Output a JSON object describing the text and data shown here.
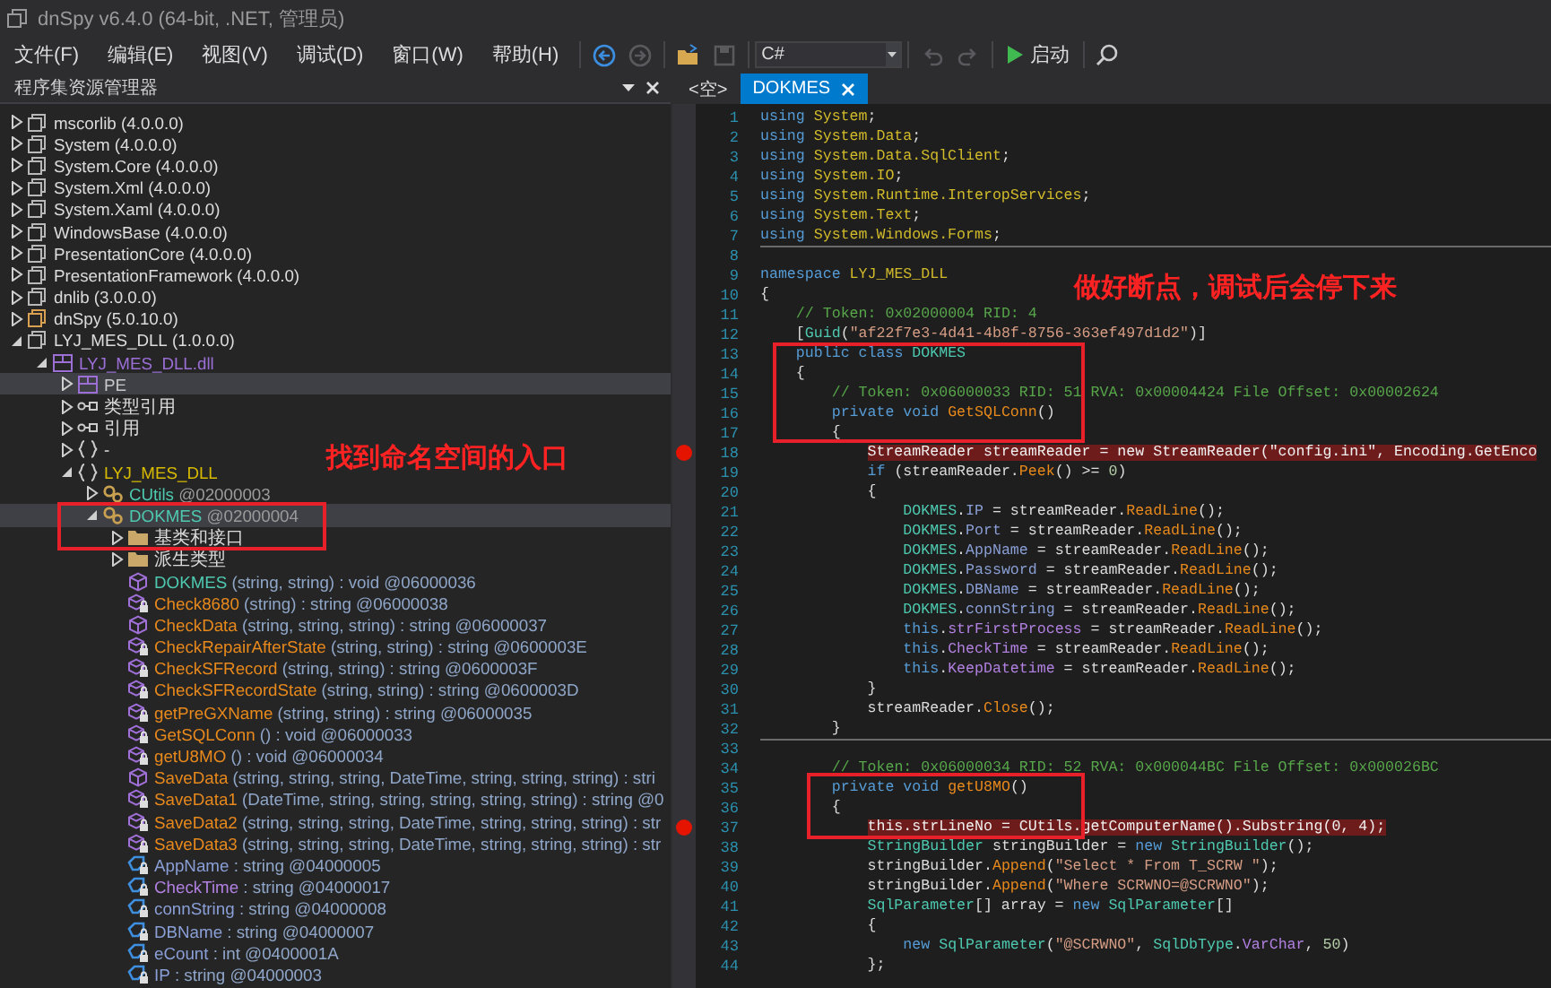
{
  "window": {
    "title": "dnSpy v6.4.0 (64-bit, .NET, 管理员)"
  },
  "menu": [
    "文件(F)",
    "编辑(E)",
    "视图(V)",
    "调试(D)",
    "窗口(W)",
    "帮助(H)"
  ],
  "toolbar": {
    "nav": [
      {
        "kind": "back",
        "disabled": false
      },
      {
        "kind": "forward",
        "disabled": true
      },
      {
        "kind": "open",
        "disabled": false
      },
      {
        "kind": "save",
        "disabled": true
      }
    ],
    "language": "C#",
    "history": [
      {
        "kind": "undo",
        "disabled": true
      },
      {
        "kind": "redo",
        "disabled": true
      }
    ],
    "start_label": "启动"
  },
  "explorer": {
    "title": "程序集资源管理器",
    "tree": [
      {
        "kind": "assembly",
        "name": "mscorlib",
        "detail": "(4.0.0.0)",
        "expanded": false,
        "selected": false
      },
      {
        "kind": "assembly",
        "name": "System",
        "detail": "(4.0.0.0)",
        "expanded": false,
        "selected": false
      },
      {
        "kind": "assembly",
        "name": "System.Core",
        "detail": "(4.0.0.0)",
        "expanded": false,
        "selected": false
      },
      {
        "kind": "assembly",
        "name": "System.Xml",
        "detail": "(4.0.0.0)",
        "expanded": false,
        "selected": false
      },
      {
        "kind": "assembly",
        "name": "System.Xaml",
        "detail": "(4.0.0.0)",
        "expanded": false,
        "selected": false
      },
      {
        "kind": "assembly",
        "name": "WindowsBase",
        "detail": "(4.0.0.0)",
        "expanded": false,
        "selected": false
      },
      {
        "kind": "assembly",
        "name": "PresentationCore",
        "detail": "(4.0.0.0)",
        "expanded": false,
        "selected": false
      },
      {
        "kind": "assembly",
        "name": "PresentationFramework",
        "detail": "(4.0.0.0)",
        "expanded": false,
        "selected": false
      },
      {
        "kind": "assembly",
        "name": "dnlib",
        "detail": "(3.0.0.0)",
        "expanded": false,
        "selected": false
      },
      {
        "kind": "exe-assembly",
        "name": "dnSpy",
        "detail": "(5.0.10.0)",
        "expanded": false,
        "selected": false
      },
      {
        "kind": "assembly",
        "name": "LYJ_MES_DLL",
        "detail": "(1.0.0.0)",
        "expanded": true,
        "selected": false,
        "children": [
          {
            "kind": "module",
            "name": "LYJ_MES_DLL.dll",
            "expanded": true,
            "selected": false,
            "children": [
              {
                "kind": "pe",
                "name": "PE",
                "expanded": false,
                "selected": true
              },
              {
                "kind": "references",
                "name": "类型引用",
                "expanded": false,
                "selected": false
              },
              {
                "kind": "references",
                "name": "引用",
                "expanded": false,
                "selected": false
              },
              {
                "kind": "global-namespace",
                "name": "-",
                "expanded": false,
                "selected": false
              },
              {
                "kind": "namespace",
                "name": "LYJ_MES_DLL",
                "expanded": true,
                "selected": false,
                "children": [
                  {
                    "kind": "class",
                    "name": "CUtils",
                    "detail": "@02000003",
                    "expanded": false,
                    "selected": false
                  },
                  {
                    "kind": "class",
                    "name": "DOKMES",
                    "detail": "@02000004",
                    "expanded": true,
                    "selected": true,
                    "children": [
                      {
                        "kind": "folder",
                        "name": "基类和接口",
                        "expanded": false,
                        "selected": false
                      },
                      {
                        "kind": "folder",
                        "name": "派生类型",
                        "expanded": false,
                        "selected": false
                      },
                      {
                        "kind": "constructor",
                        "name": "DOKMES",
                        "detail": "(string, string) : void @06000036",
                        "selected": false
                      },
                      {
                        "kind": "private-method",
                        "name": "Check8680",
                        "detail": "(string) : string @06000038",
                        "selected": false
                      },
                      {
                        "kind": "method",
                        "name": "CheckData",
                        "detail": "(string, string, string) : string @06000037",
                        "selected": false
                      },
                      {
                        "kind": "private-method",
                        "name": "CheckRepairAfterState",
                        "detail": "(string, string) : string @0600003E",
                        "selected": false
                      },
                      {
                        "kind": "private-method",
                        "name": "CheckSFRecord",
                        "detail": "(string, string) : string @0600003F",
                        "selected": false
                      },
                      {
                        "kind": "private-method",
                        "name": "CheckSFRecordState",
                        "detail": "(string, string) : string @0600003D",
                        "selected": false
                      },
                      {
                        "kind": "private-method",
                        "name": "getPreGXName",
                        "detail": "(string, string) : string @06000035",
                        "selected": false
                      },
                      {
                        "kind": "private-method",
                        "name": "GetSQLConn",
                        "detail": "() : void @06000033",
                        "selected": false
                      },
                      {
                        "kind": "private-method",
                        "name": "getU8MO",
                        "detail": "() : void @06000034",
                        "selected": false
                      },
                      {
                        "kind": "method",
                        "name": "SaveData",
                        "detail": "(string, string, string, DateTime, string, string, string) : stri",
                        "selected": false
                      },
                      {
                        "kind": "private-method",
                        "name": "SaveData1",
                        "detail": "(DateTime, string, string, string, string, string) : string @0",
                        "selected": false
                      },
                      {
                        "kind": "private-method",
                        "name": "SaveData2",
                        "detail": "(string, string, string, DateTime, string, string, string) : str",
                        "selected": false
                      },
                      {
                        "kind": "private-method",
                        "name": "SaveData3",
                        "detail": "(string, string, string, DateTime, string, string, string) : str",
                        "selected": false
                      },
                      {
                        "kind": "static-field",
                        "name": "AppName",
                        "detail": ": string @04000005",
                        "selected": false
                      },
                      {
                        "kind": "field",
                        "name": "CheckTime",
                        "detail": ": string @04000017",
                        "selected": false
                      },
                      {
                        "kind": "static-field",
                        "name": "connString",
                        "detail": ": string @04000008",
                        "selected": false
                      },
                      {
                        "kind": "static-field",
                        "name": "DBName",
                        "detail": ": string @04000007",
                        "selected": false
                      },
                      {
                        "kind": "static-field",
                        "name": "eCount",
                        "detail": ": int @0400001A",
                        "selected": false
                      },
                      {
                        "kind": "static-field",
                        "name": "IP",
                        "detail": ": string @04000003",
                        "selected": false
                      }
                    ]
                  }
                ]
              }
            ]
          }
        ]
      }
    ]
  },
  "tabs": [
    {
      "label": "<空>",
      "selected": false
    },
    {
      "label": "DOKMES",
      "selected": true
    }
  ],
  "code": {
    "lines": [
      {
        "number": "1",
        "breakpoint": false,
        "divider": false,
        "tokens": [
          {
            "kind": "kw",
            "text": "using "
          },
          {
            "kind": "ns",
            "text": "System"
          },
          {
            "kind": "p",
            "text": ";"
          }
        ]
      },
      {
        "number": "2",
        "breakpoint": false,
        "divider": false,
        "tokens": [
          {
            "kind": "kw",
            "text": "using "
          },
          {
            "kind": "ns",
            "text": "System.Data"
          },
          {
            "kind": "p",
            "text": ";"
          }
        ]
      },
      {
        "number": "3",
        "breakpoint": false,
        "divider": false,
        "tokens": [
          {
            "kind": "kw",
            "text": "using "
          },
          {
            "kind": "ns",
            "text": "System.Data.SqlClient"
          },
          {
            "kind": "p",
            "text": ";"
          }
        ]
      },
      {
        "number": "4",
        "breakpoint": false,
        "divider": false,
        "tokens": [
          {
            "kind": "kw",
            "text": "using "
          },
          {
            "kind": "ns",
            "text": "System.IO"
          },
          {
            "kind": "p",
            "text": ";"
          }
        ]
      },
      {
        "number": "5",
        "breakpoint": false,
        "divider": false,
        "tokens": [
          {
            "kind": "kw",
            "text": "using "
          },
          {
            "kind": "ns",
            "text": "System.Runtime.InteropServices"
          },
          {
            "kind": "p",
            "text": ";"
          }
        ]
      },
      {
        "number": "6",
        "breakpoint": false,
        "divider": false,
        "tokens": [
          {
            "kind": "kw",
            "text": "using "
          },
          {
            "kind": "ns",
            "text": "System.Text"
          },
          {
            "kind": "p",
            "text": ";"
          }
        ]
      },
      {
        "number": "7",
        "breakpoint": false,
        "divider": false,
        "tokens": [
          {
            "kind": "kw",
            "text": "using "
          },
          {
            "kind": "ns",
            "text": "System.Windows.Forms"
          },
          {
            "kind": "p",
            "text": ";"
          }
        ]
      },
      {
        "number": "8",
        "breakpoint": false,
        "divider": true
      },
      {
        "number": "9",
        "breakpoint": false,
        "divider": false,
        "tokens": [
          {
            "kind": "kw",
            "text": "namespace "
          },
          {
            "kind": "ns",
            "text": "LYJ_MES_DLL"
          }
        ]
      },
      {
        "number": "10",
        "breakpoint": false,
        "divider": false,
        "tokens": [
          {
            "kind": "p",
            "text": "{"
          }
        ]
      },
      {
        "number": "11",
        "breakpoint": false,
        "divider": false,
        "tokens": [
          {
            "kind": "comment",
            "text": "    // Token: 0x02000004 RID: 4"
          }
        ]
      },
      {
        "number": "12",
        "breakpoint": false,
        "divider": false,
        "tokens": [
          {
            "kind": "p",
            "text": "    ["
          },
          {
            "kind": "type",
            "text": "Guid"
          },
          {
            "kind": "p",
            "text": "("
          },
          {
            "kind": "str",
            "text": "\"af22f7e3-4d41-4b8f-8756-363ef497d1d2\""
          },
          {
            "kind": "p",
            "text": ")]"
          }
        ]
      },
      {
        "number": "13",
        "breakpoint": false,
        "divider": false,
        "tokens": [
          {
            "kind": "kw",
            "text": "    public class "
          },
          {
            "kind": "type",
            "text": "DOKMES"
          }
        ]
      },
      {
        "number": "14",
        "breakpoint": false,
        "divider": false,
        "tokens": [
          {
            "kind": "p",
            "text": "    {"
          }
        ]
      },
      {
        "number": "15",
        "breakpoint": false,
        "divider": false,
        "tokens": [
          {
            "kind": "comment",
            "text": "        // Token: 0x06000033 RID: 51 RVA: 0x00004424 File Offset: 0x00002624"
          }
        ]
      },
      {
        "number": "16",
        "breakpoint": false,
        "divider": false,
        "tokens": [
          {
            "kind": "kw",
            "text": "        private void "
          },
          {
            "kind": "method",
            "text": "GetSQLConn"
          },
          {
            "kind": "p",
            "text": "()"
          }
        ]
      },
      {
        "number": "17",
        "breakpoint": false,
        "divider": false,
        "tokens": [
          {
            "kind": "p",
            "text": "        {"
          }
        ]
      },
      {
        "number": "18",
        "breakpoint": true,
        "divider": false,
        "tokens": [
          {
            "kind": "type",
            "text": "            StreamReader"
          },
          {
            "kind": "p",
            "text": " streamReader = "
          },
          {
            "kind": "kw",
            "text": "new "
          },
          {
            "kind": "type",
            "text": "StreamReader"
          },
          {
            "kind": "p",
            "text": "("
          },
          {
            "kind": "str",
            "text": "\"config.ini\""
          },
          {
            "kind": "p",
            "text": ", "
          },
          {
            "kind": "type",
            "text": "Encoding"
          },
          {
            "kind": "p",
            "text": "."
          },
          {
            "kind": "method",
            "text": "GetEnco"
          }
        ]
      },
      {
        "number": "19",
        "breakpoint": false,
        "divider": false,
        "tokens": [
          {
            "kind": "kw",
            "text": "            if"
          },
          {
            "kind": "p",
            "text": " (streamReader."
          },
          {
            "kind": "method",
            "text": "Peek"
          },
          {
            "kind": "p",
            "text": "() >= "
          },
          {
            "kind": "num",
            "text": "0"
          },
          {
            "kind": "p",
            "text": ")"
          }
        ]
      },
      {
        "number": "20",
        "breakpoint": false,
        "divider": false,
        "tokens": [
          {
            "kind": "p",
            "text": "            {"
          }
        ]
      },
      {
        "number": "21",
        "breakpoint": false,
        "divider": false,
        "tokens": [
          {
            "kind": "type",
            "text": "                DOKMES"
          },
          {
            "kind": "p",
            "text": "."
          },
          {
            "kind": "sfield",
            "text": "IP"
          },
          {
            "kind": "p",
            "text": " = streamReader."
          },
          {
            "kind": "method",
            "text": "ReadLine"
          },
          {
            "kind": "p",
            "text": "();"
          }
        ]
      },
      {
        "number": "22",
        "breakpoint": false,
        "divider": false,
        "tokens": [
          {
            "kind": "type",
            "text": "                DOKMES"
          },
          {
            "kind": "p",
            "text": "."
          },
          {
            "kind": "sfield",
            "text": "Port"
          },
          {
            "kind": "p",
            "text": " = streamReader."
          },
          {
            "kind": "method",
            "text": "ReadLine"
          },
          {
            "kind": "p",
            "text": "();"
          }
        ]
      },
      {
        "number": "23",
        "breakpoint": false,
        "divider": false,
        "tokens": [
          {
            "kind": "type",
            "text": "                DOKMES"
          },
          {
            "kind": "p",
            "text": "."
          },
          {
            "kind": "sfield",
            "text": "AppName"
          },
          {
            "kind": "p",
            "text": " = streamReader."
          },
          {
            "kind": "method",
            "text": "ReadLine"
          },
          {
            "kind": "p",
            "text": "();"
          }
        ]
      },
      {
        "number": "24",
        "breakpoint": false,
        "divider": false,
        "tokens": [
          {
            "kind": "type",
            "text": "                DOKMES"
          },
          {
            "kind": "p",
            "text": "."
          },
          {
            "kind": "sfield",
            "text": "Password"
          },
          {
            "kind": "p",
            "text": " = streamReader."
          },
          {
            "kind": "method",
            "text": "ReadLine"
          },
          {
            "kind": "p",
            "text": "();"
          }
        ]
      },
      {
        "number": "25",
        "breakpoint": false,
        "divider": false,
        "tokens": [
          {
            "kind": "type",
            "text": "                DOKMES"
          },
          {
            "kind": "p",
            "text": "."
          },
          {
            "kind": "sfield",
            "text": "DBName"
          },
          {
            "kind": "p",
            "text": " = streamReader."
          },
          {
            "kind": "method",
            "text": "ReadLine"
          },
          {
            "kind": "p",
            "text": "();"
          }
        ]
      },
      {
        "number": "26",
        "breakpoint": false,
        "divider": false,
        "tokens": [
          {
            "kind": "type",
            "text": "                DOKMES"
          },
          {
            "kind": "p",
            "text": "."
          },
          {
            "kind": "sfield",
            "text": "connString"
          },
          {
            "kind": "p",
            "text": " = streamReader."
          },
          {
            "kind": "method",
            "text": "ReadLine"
          },
          {
            "kind": "p",
            "text": "();"
          }
        ]
      },
      {
        "number": "27",
        "breakpoint": false,
        "divider": false,
        "tokens": [
          {
            "kind": "kw",
            "text": "                this"
          },
          {
            "kind": "p",
            "text": "."
          },
          {
            "kind": "field",
            "text": "strFirstProcess"
          },
          {
            "kind": "p",
            "text": " = streamReader."
          },
          {
            "kind": "method",
            "text": "ReadLine"
          },
          {
            "kind": "p",
            "text": "();"
          }
        ]
      },
      {
        "number": "28",
        "breakpoint": false,
        "divider": false,
        "tokens": [
          {
            "kind": "kw",
            "text": "                this"
          },
          {
            "kind": "p",
            "text": "."
          },
          {
            "kind": "field",
            "text": "CheckTime"
          },
          {
            "kind": "p",
            "text": " = streamReader."
          },
          {
            "kind": "method",
            "text": "ReadLine"
          },
          {
            "kind": "p",
            "text": "();"
          }
        ]
      },
      {
        "number": "29",
        "breakpoint": false,
        "divider": false,
        "tokens": [
          {
            "kind": "kw",
            "text": "                this"
          },
          {
            "kind": "p",
            "text": "."
          },
          {
            "kind": "field",
            "text": "KeepDatetime"
          },
          {
            "kind": "p",
            "text": " = streamReader."
          },
          {
            "kind": "method",
            "text": "ReadLine"
          },
          {
            "kind": "p",
            "text": "();"
          }
        ]
      },
      {
        "number": "30",
        "breakpoint": false,
        "divider": false,
        "tokens": [
          {
            "kind": "p",
            "text": "            }"
          }
        ]
      },
      {
        "number": "31",
        "breakpoint": false,
        "divider": false,
        "tokens": [
          {
            "kind": "p",
            "text": "            streamReader."
          },
          {
            "kind": "method",
            "text": "Close"
          },
          {
            "kind": "p",
            "text": "();"
          }
        ]
      },
      {
        "number": "32",
        "breakpoint": false,
        "divider": false,
        "tokens": [
          {
            "kind": "p",
            "text": "        }"
          }
        ]
      },
      {
        "number": "33",
        "breakpoint": false,
        "divider": true
      },
      {
        "number": "34",
        "breakpoint": false,
        "divider": false,
        "tokens": [
          {
            "kind": "comment",
            "text": "        // Token: 0x06000034 RID: 52 RVA: 0x000044BC File Offset: 0x000026BC"
          }
        ]
      },
      {
        "number": "35",
        "breakpoint": false,
        "divider": false,
        "tokens": [
          {
            "kind": "kw",
            "text": "        private void "
          },
          {
            "kind": "method",
            "text": "getU8MO"
          },
          {
            "kind": "p",
            "text": "()"
          }
        ]
      },
      {
        "number": "36",
        "breakpoint": false,
        "divider": false,
        "tokens": [
          {
            "kind": "p",
            "text": "        {"
          }
        ]
      },
      {
        "number": "37",
        "breakpoint": true,
        "divider": false,
        "tokens": [
          {
            "kind": "kw",
            "text": "            this"
          },
          {
            "kind": "p",
            "text": "."
          },
          {
            "kind": "field",
            "text": "strLineNo"
          },
          {
            "kind": "p",
            "text": " = "
          },
          {
            "kind": "type",
            "text": "CUtils"
          },
          {
            "kind": "p",
            "text": "."
          },
          {
            "kind": "method",
            "text": "getComputerName"
          },
          {
            "kind": "p",
            "text": "()."
          },
          {
            "kind": "method",
            "text": "Substring"
          },
          {
            "kind": "p",
            "text": "("
          },
          {
            "kind": "num",
            "text": "0"
          },
          {
            "kind": "p",
            "text": ", "
          },
          {
            "kind": "num",
            "text": "4"
          },
          {
            "kind": "p",
            "text": ");"
          }
        ]
      },
      {
        "number": "38",
        "breakpoint": false,
        "divider": false,
        "tokens": [
          {
            "kind": "type",
            "text": "            StringBuilder"
          },
          {
            "kind": "p",
            "text": " stringBuilder = "
          },
          {
            "kind": "kw",
            "text": "new "
          },
          {
            "kind": "type",
            "text": "StringBuilder"
          },
          {
            "kind": "p",
            "text": "();"
          }
        ]
      },
      {
        "number": "39",
        "breakpoint": false,
        "divider": false,
        "tokens": [
          {
            "kind": "p",
            "text": "            stringBuilder."
          },
          {
            "kind": "method",
            "text": "Append"
          },
          {
            "kind": "p",
            "text": "("
          },
          {
            "kind": "str",
            "text": "\"Select * From T_SCRW \""
          },
          {
            "kind": "p",
            "text": ");"
          }
        ]
      },
      {
        "number": "40",
        "breakpoint": false,
        "divider": false,
        "tokens": [
          {
            "kind": "p",
            "text": "            stringBuilder."
          },
          {
            "kind": "method",
            "text": "Append"
          },
          {
            "kind": "p",
            "text": "("
          },
          {
            "kind": "str",
            "text": "\"Where SCRWNO=@SCRWNO\""
          },
          {
            "kind": "p",
            "text": ");"
          }
        ]
      },
      {
        "number": "41",
        "breakpoint": false,
        "divider": false,
        "tokens": [
          {
            "kind": "type",
            "text": "            SqlParameter"
          },
          {
            "kind": "p",
            "text": "[] array = "
          },
          {
            "kind": "kw",
            "text": "new "
          },
          {
            "kind": "type",
            "text": "SqlParameter"
          },
          {
            "kind": "p",
            "text": "[]"
          }
        ]
      },
      {
        "number": "42",
        "breakpoint": false,
        "divider": false,
        "tokens": [
          {
            "kind": "p",
            "text": "            {"
          }
        ]
      },
      {
        "number": "43",
        "breakpoint": false,
        "divider": false,
        "tokens": [
          {
            "kind": "kw",
            "text": "                new "
          },
          {
            "kind": "type",
            "text": "SqlParameter"
          },
          {
            "kind": "p",
            "text": "("
          },
          {
            "kind": "str",
            "text": "\"@SCRWNO\""
          },
          {
            "kind": "p",
            "text": ", "
          },
          {
            "kind": "type",
            "text": "SqlDbType"
          },
          {
            "kind": "p",
            "text": "."
          },
          {
            "kind": "field",
            "text": "VarChar"
          },
          {
            "kind": "p",
            "text": ", "
          },
          {
            "kind": "num",
            "text": "50"
          },
          {
            "kind": "p",
            "text": ")"
          }
        ]
      },
      {
        "number": "44",
        "breakpoint": false,
        "divider": false,
        "tokens": [
          {
            "kind": "p",
            "text": "            };"
          }
        ]
      }
    ]
  },
  "notes": [
    {
      "text": "找到命名空间的入口"
    },
    {
      "text": "做好断点，调试后会停下来"
    }
  ]
}
